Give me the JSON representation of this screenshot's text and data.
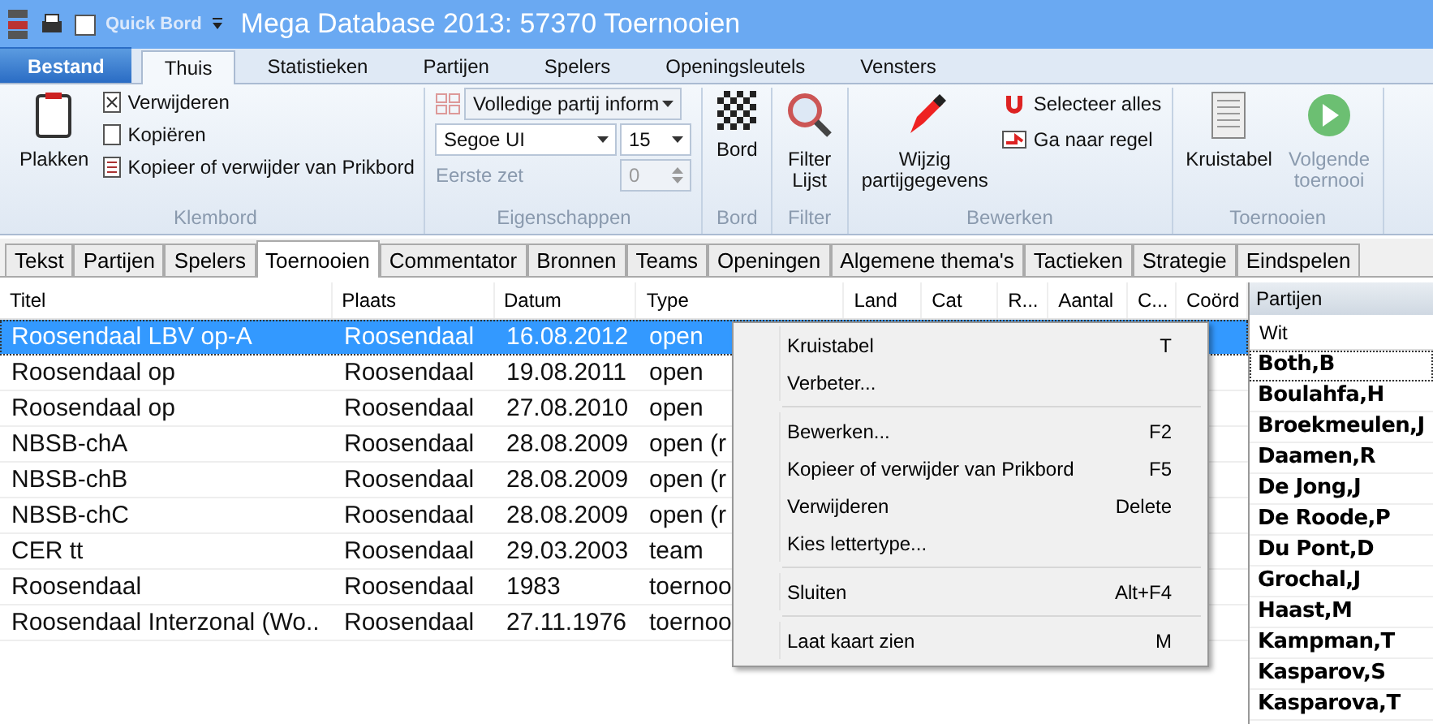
{
  "window": {
    "title": "Mega Database 2013:  57370 Toernooien",
    "quick_access": {
      "label": "Quick Bord",
      "checked": false
    }
  },
  "ribbon_tabs": [
    {
      "label": "Bestand",
      "kind": "file",
      "selected": false
    },
    {
      "label": "Thuis",
      "kind": "tab",
      "selected": true
    },
    {
      "label": "Statistieken",
      "kind": "tab",
      "selected": false
    },
    {
      "label": "Partijen",
      "kind": "tab",
      "selected": false
    },
    {
      "label": "Spelers",
      "kind": "tab",
      "selected": false
    },
    {
      "label": "Openingsleutels",
      "kind": "tab",
      "selected": false
    },
    {
      "label": "Vensters",
      "kind": "tab",
      "selected": false
    }
  ],
  "ribbon": {
    "klembord": {
      "title": "Klembord",
      "paste": "Plakken",
      "items": [
        "Verwijderen",
        "Kopiëren",
        "Kopieer of verwijder van Prikbord"
      ]
    },
    "eigenschappen": {
      "title": "Eigenschappen",
      "view": "Volledige partij inform",
      "font": "Segoe UI",
      "size": "15",
      "first_move_label": "Eerste zet",
      "first_move": "0",
      "first_move_disabled": true
    },
    "bord": {
      "title": "Bord",
      "button": "Bord"
    },
    "filter": {
      "title": "Filter",
      "button": "Filter\nLijst"
    },
    "bewerken": {
      "title": "Bewerken",
      "button": "Wijzig\npartijgegevens",
      "items": [
        "Selecteer alles",
        "Ga naar regel"
      ]
    },
    "toernooien": {
      "title": "Toernooien",
      "buttons": [
        {
          "label": "Kruistabel",
          "disabled": false
        },
        {
          "label": "Volgende\ntoernooi",
          "disabled": true
        }
      ]
    }
  },
  "doc_tabs": [
    {
      "label": "Tekst",
      "selected": false
    },
    {
      "label": "Partijen",
      "selected": false
    },
    {
      "label": "Spelers",
      "selected": false
    },
    {
      "label": "Toernooien",
      "selected": true
    },
    {
      "label": "Commentator",
      "selected": false
    },
    {
      "label": "Bronnen",
      "selected": false
    },
    {
      "label": "Teams",
      "selected": false
    },
    {
      "label": "Openingen",
      "selected": false
    },
    {
      "label": "Algemene thema's",
      "selected": false
    },
    {
      "label": "Tactieken",
      "selected": false
    },
    {
      "label": "Strategie",
      "selected": false
    },
    {
      "label": "Eindspelen",
      "selected": false
    }
  ],
  "table": {
    "columns": [
      "Titel",
      "Plaats",
      "Datum",
      "Type",
      "Land",
      "Cat",
      "R...",
      "Aantal",
      "C...",
      "Coörd"
    ],
    "rows": [
      {
        "cells": [
          "Roosendaal LBV op-A",
          "Roosendaal",
          "16.08.2012",
          "open"
        ],
        "selected": true
      },
      {
        "cells": [
          "Roosendaal op",
          "Roosendaal",
          "19.08.2011",
          "open"
        ],
        "selected": false
      },
      {
        "cells": [
          "Roosendaal op",
          "Roosendaal",
          "27.08.2010",
          "open"
        ],
        "selected": false
      },
      {
        "cells": [
          "NBSB-chA",
          "Roosendaal",
          "28.08.2009",
          "open (r"
        ],
        "selected": false
      },
      {
        "cells": [
          "NBSB-chB",
          "Roosendaal",
          "28.08.2009",
          "open (r"
        ],
        "selected": false
      },
      {
        "cells": [
          "NBSB-chC",
          "Roosendaal",
          "28.08.2009",
          "open (r"
        ],
        "selected": false
      },
      {
        "cells": [
          "CER tt",
          "Roosendaal",
          "29.03.2003",
          "team"
        ],
        "selected": false
      },
      {
        "cells": [
          "Roosendaal",
          "Roosendaal",
          "1983",
          "toernoo"
        ],
        "selected": false
      },
      {
        "cells": [
          "Roosendaal Interzonal (Wo..",
          "Roosendaal",
          "27.11.1976",
          "toernoo"
        ],
        "selected": false
      }
    ]
  },
  "context_menu": [
    {
      "label": "Kruistabel",
      "shortcut": "T",
      "separator_after": false
    },
    {
      "label": "Verbeter...",
      "separator_after": true
    },
    {
      "label": "Bewerken...",
      "shortcut": "F2",
      "separator_after": false
    },
    {
      "label": "Kopieer of verwijder van Prikbord",
      "shortcut": "F5",
      "separator_after": false
    },
    {
      "label": "Verwijderen",
      "shortcut": "Delete",
      "separator_after": false
    },
    {
      "label": "Kies lettertype...",
      "separator_after": true
    },
    {
      "label": "Sluiten",
      "shortcut": "Alt+F4",
      "separator_after": true
    },
    {
      "label": "Laat kaart zien",
      "shortcut": "M",
      "separator_after": false
    }
  ],
  "side_panel": {
    "title": "Partijen",
    "header": "Wit",
    "players": [
      {
        "name": "Both,B",
        "selected": true
      },
      {
        "name": "Boulahfa,H",
        "selected": false
      },
      {
        "name": "Broekmeulen,J",
        "selected": false
      },
      {
        "name": "Daamen,R",
        "selected": false
      },
      {
        "name": "De Jong,J",
        "selected": false
      },
      {
        "name": "De Roode,P",
        "selected": false
      },
      {
        "name": "Du Pont,D",
        "selected": false
      },
      {
        "name": "Grochal,J",
        "selected": false
      },
      {
        "name": "Haast,M",
        "selected": false
      },
      {
        "name": "Kampman,T",
        "selected": false
      },
      {
        "name": "Kasparov,S",
        "selected": false
      },
      {
        "name": "Kasparova,T",
        "selected": false
      }
    ]
  }
}
